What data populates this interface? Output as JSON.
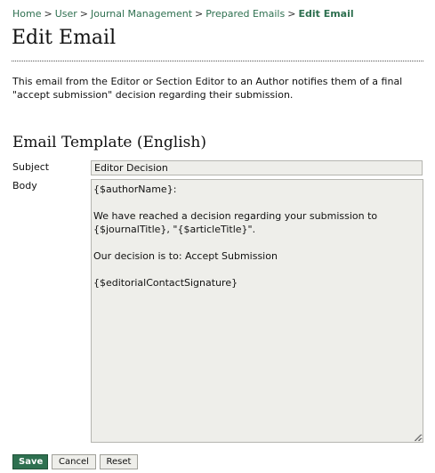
{
  "breadcrumb": {
    "items": [
      "Home",
      "User",
      "Journal Management",
      "Prepared Emails"
    ],
    "separator": ">",
    "current": "Edit Email"
  },
  "page": {
    "title": "Edit Email",
    "description": "This email from the Editor or Section Editor to an Author notifies them of a final \"accept submission\" decision regarding their submission."
  },
  "template": {
    "section_title": "Email Template (English)",
    "subject_label": "Subject",
    "subject_value": "Editor Decision",
    "body_label": "Body",
    "body_value": "{$authorName}:\n\nWe have reached a decision regarding your submission to {$journalTitle}, \"{$articleTitle}\".\n\nOur decision is to: Accept Submission\n\n{$editorialContactSignature}"
  },
  "buttons": {
    "save": "Save",
    "cancel": "Cancel",
    "reset": "Reset"
  },
  "colors": {
    "accent": "#2e7050",
    "field_bg": "#eeeeea"
  }
}
